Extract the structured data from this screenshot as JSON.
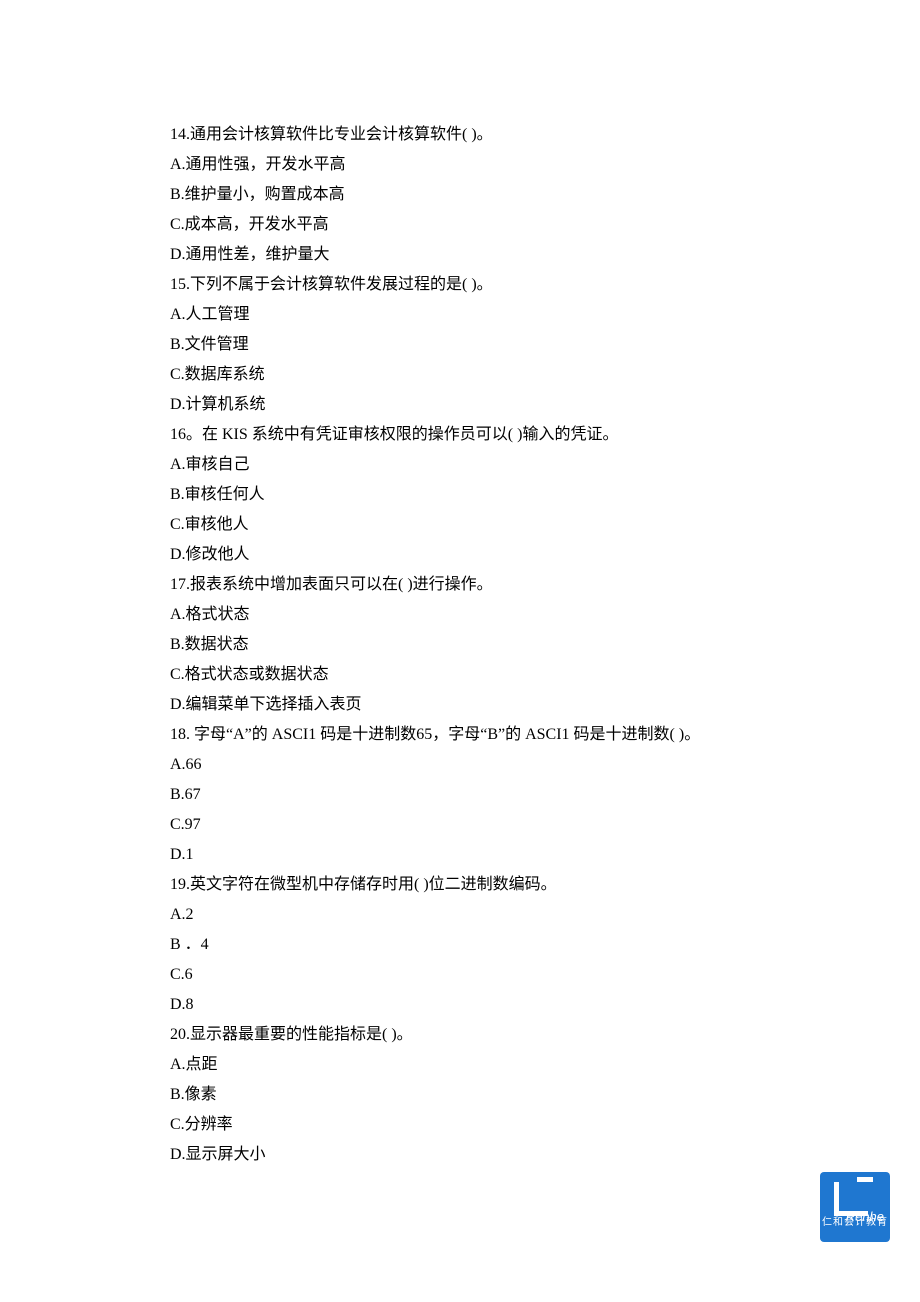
{
  "questions": [
    {
      "stem": "14.通用会计核算软件比专业会计核算软件(   )。",
      "options": [
        "A.通用性强，开发水平高",
        "B.维护量小，购置成本高",
        "C.成本高，开发水平高",
        "D.通用性差，维护量大"
      ]
    },
    {
      "stem": "15.下列不属于会计核算软件发展过程的是(   )。",
      "options": [
        "A.人工管理",
        "B.文件管理",
        "C.数据库系统",
        "D.计算机系统"
      ]
    },
    {
      "stem": "16。在 KIS 系统中有凭证审核权限的操作员可以(   )输入的凭证。",
      "options": [
        "A.审核自己",
        "B.审核任何人",
        "C.审核他人",
        "D.修改他人"
      ]
    },
    {
      "stem": "17.报表系统中增加表面只可以在(   )进行操作。",
      "options": [
        "A.格式状态",
        "B.数据状态",
        "C.格式状态或数据状态",
        "D.编辑菜单下选择插入表页"
      ]
    },
    {
      "stem": "18. 字母“A”的 ASCI1 码是十进制数65，字母“B”的 ASCI1 码是十进制数(   )。",
      "options": [
        "A.66",
        "B.67",
        "C.97",
        "D.1"
      ]
    },
    {
      "stem": "19.英文字符在微型机中存储存时用(   )位二进制数编码。",
      "options": [
        "A.2",
        "B ．4",
        "C.6",
        "D.8"
      ]
    },
    {
      "stem": "20.显示器最重要的性能指标是(   )。",
      "options": [
        "A.点距",
        "B.像素",
        "C.分辨率",
        "D.显示屏大小"
      ]
    }
  ],
  "logo": {
    "script": "Renhe",
    "label": "仁和会计教育"
  }
}
